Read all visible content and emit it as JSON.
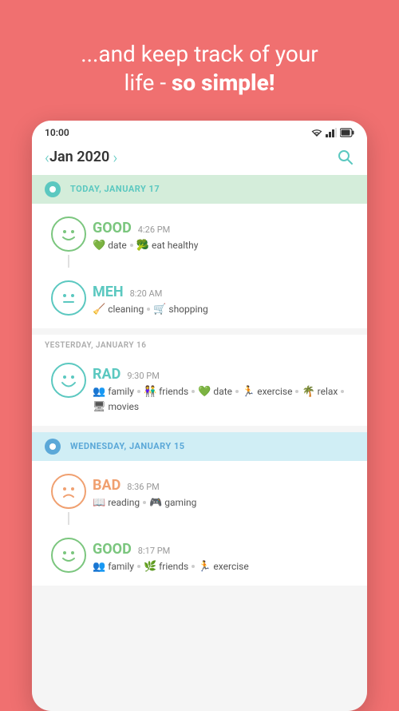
{
  "header": {
    "line1": "...and keep track of your",
    "line2_normal": "life - ",
    "line2_bold": "so simple!"
  },
  "statusBar": {
    "time": "10:00"
  },
  "nav": {
    "title": "Jan 2020",
    "left_arrow": "‹",
    "right_arrow": "›"
  },
  "days": [
    {
      "id": "today",
      "label": "TODAY, JANUARY 17",
      "dotColor": "teal",
      "entries": [
        {
          "mood": "GOOD",
          "moodClass": "mood-good",
          "time": "4:26 PM",
          "tags": [
            {
              "icon": "💚",
              "label": "date"
            },
            {
              "icon": "🥦",
              "label": "eat healthy"
            }
          ],
          "smileyClass": "smiley-good",
          "smileyFace": "😊",
          "faceColor": "#7BC67E"
        },
        {
          "mood": "MEH",
          "moodClass": "mood-meh",
          "time": "8:20 AM",
          "tags": [
            {
              "icon": "🧹",
              "label": "cleaning"
            },
            {
              "icon": "🛒",
              "label": "shopping"
            }
          ],
          "smileyClass": "smiley-meh",
          "smileyFace": "😐",
          "faceColor": "#5BC8C0"
        }
      ]
    },
    {
      "id": "yesterday",
      "label": "YESTERDAY, JANUARY 16",
      "entries": [
        {
          "mood": "RAD",
          "moodClass": "mood-rad",
          "time": "9:30 PM",
          "tags": [
            {
              "icon": "👥",
              "label": "family"
            },
            {
              "icon": "👫",
              "label": "friends"
            },
            {
              "icon": "💚",
              "label": "date"
            },
            {
              "icon": "🏃",
              "label": "exercise"
            },
            {
              "icon": "🌴",
              "label": "relax"
            },
            {
              "icon": "🖥",
              "label": "movies"
            }
          ],
          "smileyClass": "smiley-rad",
          "smileyFace": "😄",
          "faceColor": "#5BC8C0"
        }
      ]
    },
    {
      "id": "wednesday",
      "label": "WEDNESDAY, JANUARY 15",
      "dotColor": "blue",
      "entries": [
        {
          "mood": "BAD",
          "moodClass": "mood-bad",
          "time": "8:36 PM",
          "tags": [
            {
              "icon": "📖",
              "label": "reading"
            },
            {
              "icon": "🎮",
              "label": "gaming"
            }
          ],
          "smileyClass": "smiley-bad",
          "smileyFace": "😟",
          "faceColor": "#F0A070"
        },
        {
          "mood": "GOOD",
          "moodClass": "mood-good",
          "time": "8:17 PM",
          "tags": [
            {
              "icon": "👥",
              "label": "family"
            },
            {
              "icon": "🌿",
              "label": "friends"
            },
            {
              "icon": "🏃",
              "label": "exercise"
            }
          ],
          "smileyClass": "smiley-good",
          "smileyFace": "😊",
          "faceColor": "#7BC67E"
        }
      ]
    }
  ]
}
